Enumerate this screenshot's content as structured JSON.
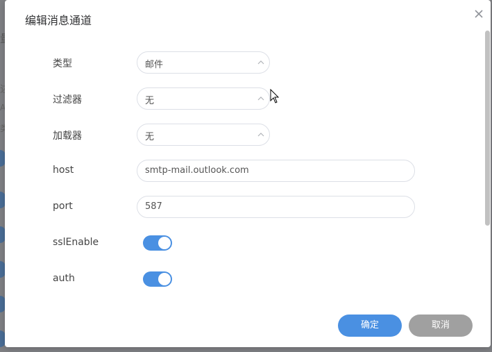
{
  "background": {
    "glyphs": [
      "量",
      "述",
      "A",
      "类"
    ]
  },
  "dialog": {
    "title": "编辑消息通道",
    "close_icon": "close-icon"
  },
  "form": {
    "type": {
      "label": "类型",
      "value": "邮件"
    },
    "filter": {
      "label": "过滤器",
      "value": "无"
    },
    "loader": {
      "label": "加载器",
      "value": "无"
    },
    "host": {
      "label": "host",
      "value": "smtp-mail.outlook.com"
    },
    "port": {
      "label": "port",
      "value": "587"
    },
    "ssl_enable": {
      "label": "sslEnable",
      "value": true
    },
    "auth": {
      "label": "auth",
      "value": true
    }
  },
  "footer": {
    "confirm_label": "确定",
    "cancel_label": "取消"
  },
  "colors": {
    "primary": "#4a90e2",
    "cancel": "#a0a0a0",
    "border": "#dcdfe6"
  }
}
